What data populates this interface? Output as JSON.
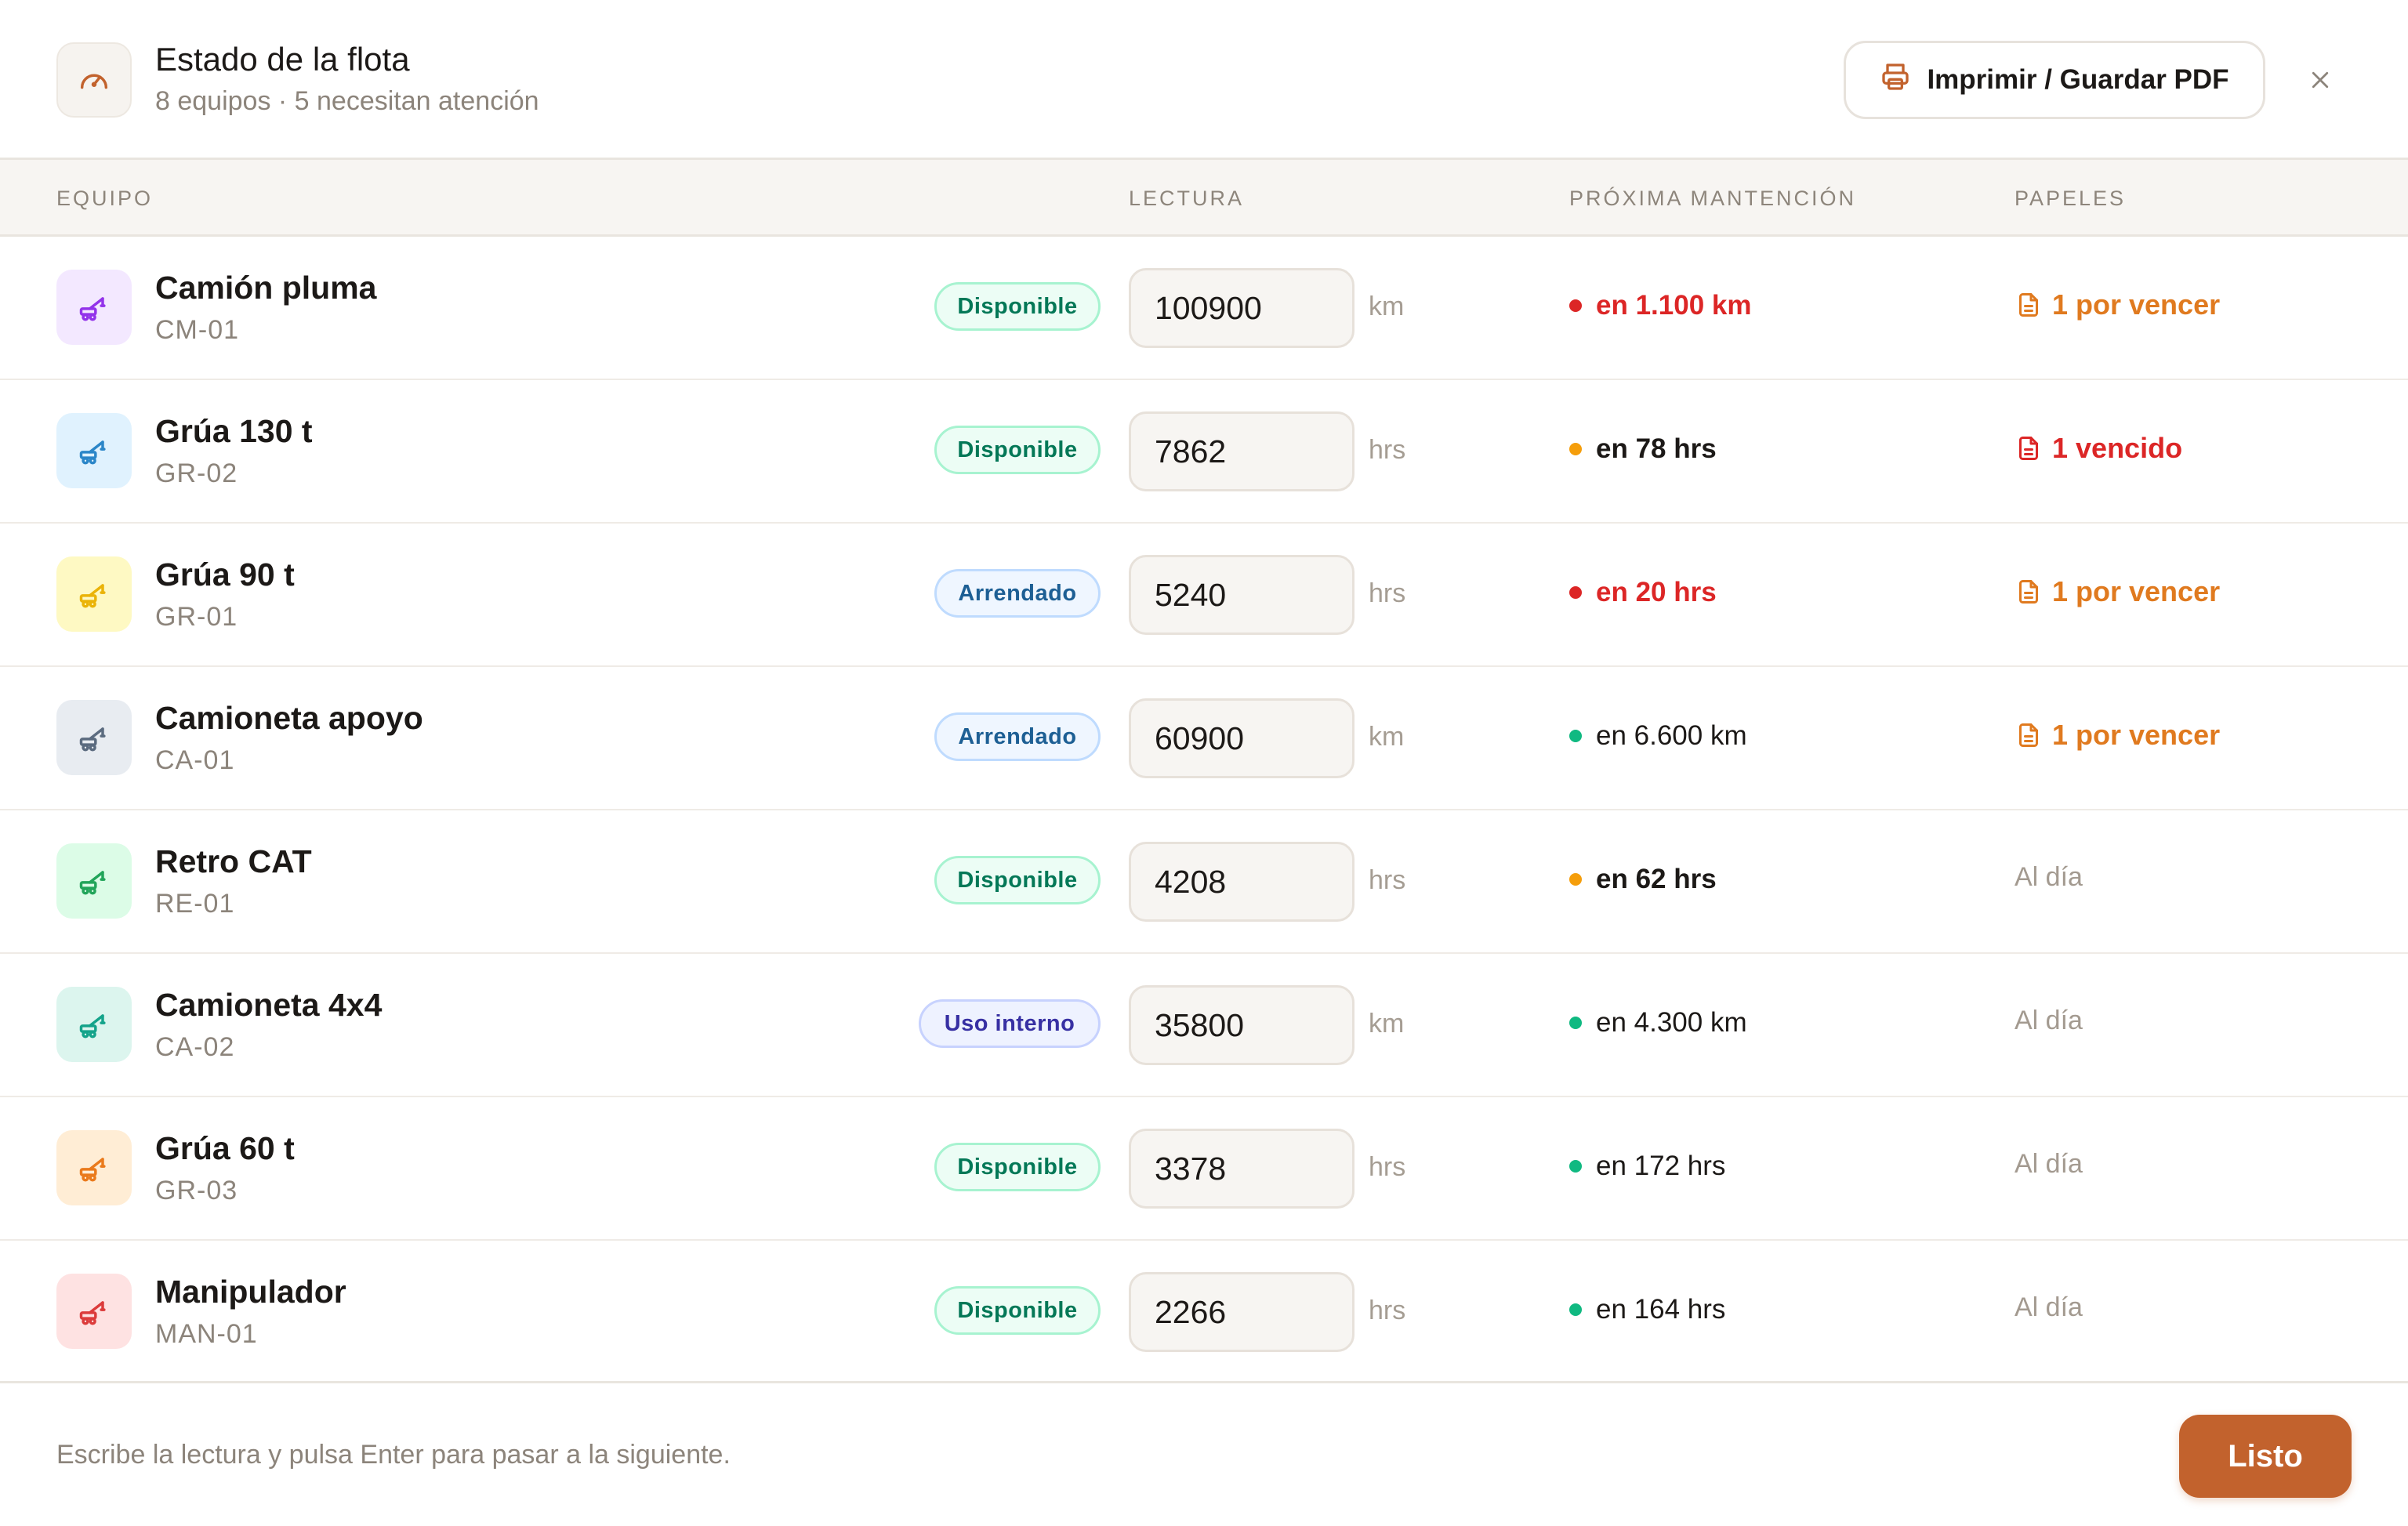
{
  "header": {
    "title": "Estado de la flota",
    "subtitle": "8 equipos · 5 necesitan atención",
    "icon": "gauge-icon",
    "print_label": "Imprimir / Guardar PDF",
    "close_icon": "close-icon"
  },
  "columns": {
    "equipo": "EQUIPO",
    "lectura": "LECTURA",
    "mantencion": "PRÓXIMA MANTENCIÓN",
    "papeles": "PAPELES"
  },
  "colors": {
    "accent": "#c2622d",
    "red": "#dc2626",
    "orange": "#f59e0b",
    "green": "#10b981",
    "paper_orange": "#e07a1f",
    "paper_red": "#dc2626"
  },
  "rows": [
    {
      "name": "Camión pluma",
      "code": "CM-01",
      "status": "Disponible",
      "reading": "100900",
      "unit": "km",
      "maint": "en 1.100 km",
      "maint_level": "red",
      "papers": "1 por vencer",
      "papers_level": "warn",
      "icon_bg": "#f3e8ff",
      "icon_color": "#9333ea"
    },
    {
      "name": "Grúa 130 t",
      "code": "GR-02",
      "status": "Disponible",
      "reading": "7862",
      "unit": "hrs",
      "maint": "en 78 hrs",
      "maint_level": "orange",
      "papers": "1 vencido",
      "papers_level": "danger",
      "icon_bg": "#e0f2fe",
      "icon_color": "#2b86c8"
    },
    {
      "name": "Grúa 90 t",
      "code": "GR-01",
      "status": "Arrendado",
      "reading": "5240",
      "unit": "hrs",
      "maint": "en 20 hrs",
      "maint_level": "red",
      "papers": "1 por vencer",
      "papers_level": "warn",
      "icon_bg": "#fef9c3",
      "icon_color": "#eab308"
    },
    {
      "name": "Camioneta apoyo",
      "code": "CA-01",
      "status": "Arrendado",
      "reading": "60900",
      "unit": "km",
      "maint": "en 6.600 km",
      "maint_level": "green",
      "papers": "1 por vencer",
      "papers_level": "warn",
      "icon_bg": "#e8ecf1",
      "icon_color": "#5b6b7f"
    },
    {
      "name": "Retro CAT",
      "code": "RE-01",
      "status": "Disponible",
      "reading": "4208",
      "unit": "hrs",
      "maint": "en 62 hrs",
      "maint_level": "orange",
      "papers": "Al día",
      "papers_level": "ok",
      "icon_bg": "#dcfce7",
      "icon_color": "#22a55a"
    },
    {
      "name": "Camioneta 4x4",
      "code": "CA-02",
      "status": "Uso interno",
      "reading": "35800",
      "unit": "km",
      "maint": "en 4.300 km",
      "maint_level": "green",
      "papers": "Al día",
      "papers_level": "ok",
      "icon_bg": "#dcf5ee",
      "icon_color": "#14a38a"
    },
    {
      "name": "Grúa 60 t",
      "code": "GR-03",
      "status": "Disponible",
      "reading": "3378",
      "unit": "hrs",
      "maint": "en 172 hrs",
      "maint_level": "green",
      "papers": "Al día",
      "papers_level": "ok",
      "icon_bg": "#ffedd5",
      "icon_color": "#ea7a1c"
    },
    {
      "name": "Manipulador",
      "code": "MAN-01",
      "status": "Disponible",
      "reading": "2266",
      "unit": "hrs",
      "maint": "en 164 hrs",
      "maint_level": "green",
      "papers": "Al día",
      "papers_level": "ok",
      "icon_bg": "#fee2e2",
      "icon_color": "#dc3b3b"
    }
  ],
  "footer": {
    "hint": "Escribe la lectura y pulsa Enter para pasar a la siguiente.",
    "done_label": "Listo"
  }
}
